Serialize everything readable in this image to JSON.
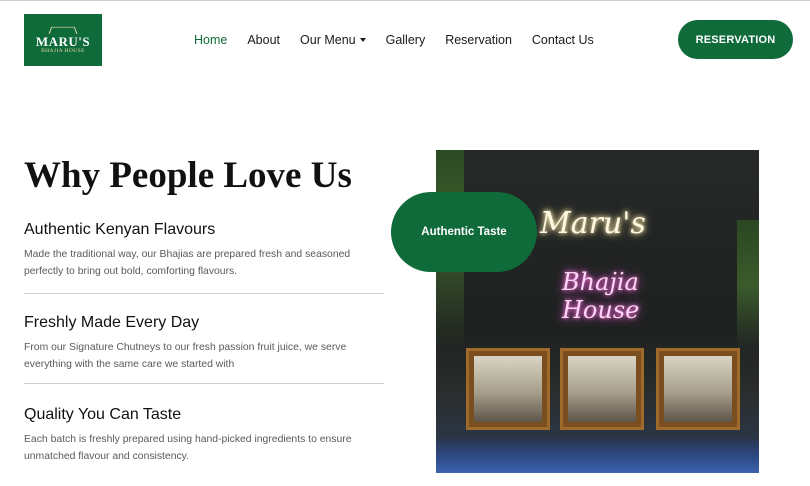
{
  "brand": {
    "name": "MARU'S",
    "tagline": "BHAJIA HOUSE",
    "color": "#0f6b3a"
  },
  "nav": {
    "items": [
      {
        "label": "Home",
        "active": true
      },
      {
        "label": "About",
        "active": false
      },
      {
        "label": "Our Menu",
        "active": false,
        "has_dropdown": true
      },
      {
        "label": "Gallery",
        "active": false
      },
      {
        "label": "Reservation",
        "active": false
      },
      {
        "label": "Contact Us",
        "active": false
      }
    ],
    "cta_label": "RESERVATION"
  },
  "section": {
    "title": "Why People Love Us",
    "features": [
      {
        "heading": "Authentic Kenyan Flavours",
        "text": "Made the traditional way, our Bhajias are prepared fresh and seasoned perfectly to bring out bold, comforting flavours."
      },
      {
        "heading": "Freshly Made Every Day",
        "text": "From our Signature Chutneys to our fresh passion fruit juice, we serve everything with the same care we started with"
      },
      {
        "heading": "Quality You Can Taste",
        "text": "Each batch is freshly prepared using hand-picked ingredients to ensure unmatched flavour and consistency."
      }
    ]
  },
  "photo": {
    "badge_label": "Authentic Taste",
    "neon_top": "Maru's",
    "neon_bottom_line1": "Bhajia",
    "neon_bottom_line2": "House"
  }
}
